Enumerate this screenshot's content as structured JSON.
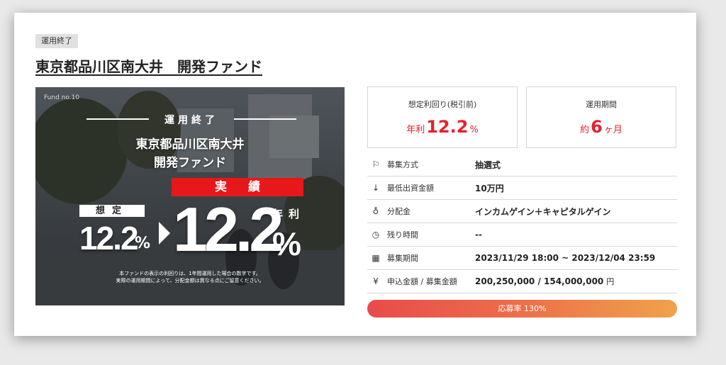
{
  "status_tag": "運用終了",
  "title": "東京都品川区南大井　開発ファンド",
  "banner": {
    "fund_no": "Fund no.10",
    "status": "運用終了",
    "name_line1": "東京都品川区南大井",
    "name_line2": "開発ファンド",
    "actual_label": "実績",
    "expected_label": "想定",
    "expected_value": "12.2",
    "expected_unit": "%",
    "actual_value": "12.2",
    "annual_label": "年利",
    "actual_unit": "%",
    "note_line1": "本ファンドの表示の利回りは、1年間運用した場合の数字です。",
    "note_line2": "実際の運用期間によって、分配金額は異なる点にご留意ください。"
  },
  "stats": {
    "yield": {
      "label": "想定利回り(税引前)",
      "prefix": "年利",
      "value": "12.2",
      "suffix": "%"
    },
    "period": {
      "label": "運用期間",
      "prefix": "約",
      "value": "6",
      "suffix": "ヶ月"
    }
  },
  "details": [
    {
      "icon": "flag-icon",
      "glyph": "⚐",
      "label": "募集方式",
      "value": "抽選式",
      "unit": ""
    },
    {
      "icon": "arrow-down-icon",
      "glyph": "↓",
      "label": "最低出資金額",
      "value": "10万円",
      "unit": ""
    },
    {
      "icon": "piggy-bank-icon",
      "glyph": "♁",
      "label": "分配金",
      "value": "インカムゲイン＋キャピタルゲイン",
      "unit": ""
    },
    {
      "icon": "clock-icon",
      "glyph": "◷",
      "label": "残り時間",
      "value": "--",
      "unit": ""
    },
    {
      "icon": "calendar-icon",
      "glyph": "▦",
      "label": "募集期間",
      "value": "2023/11/29 18:00 ~ 2023/12/04 23:59",
      "unit": ""
    },
    {
      "icon": "yen-icon",
      "glyph": "¥",
      "label": "申込金額 / 募集金額",
      "value": "200,250,000 / 154,000,000",
      "unit": "円"
    }
  ],
  "progress": {
    "label": "応募率 130%",
    "percent": 130
  },
  "colors": {
    "accent": "#e5202e",
    "progress_start": "#e94b4b",
    "progress_end": "#f0a24a"
  }
}
